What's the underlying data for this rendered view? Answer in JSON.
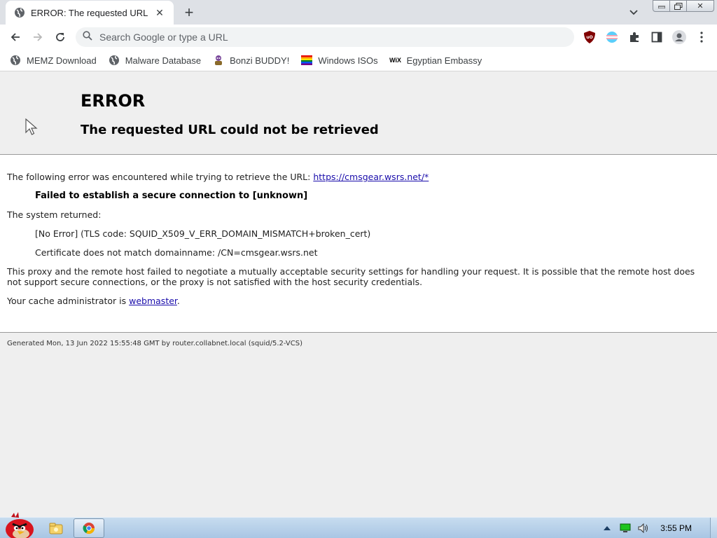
{
  "browser": {
    "tab_title": "ERROR: The requested URL co",
    "omnibox_placeholder": "Search Google or type a URL",
    "bookmarks": [
      {
        "label": "MEMZ Download",
        "icon": "globe-icon"
      },
      {
        "label": "Malware Database",
        "icon": "globe-icon"
      },
      {
        "label": "Bonzi BUDDY!",
        "icon": "bonzi-icon"
      },
      {
        "label": "Windows ISOs",
        "icon": "rainbow-flag-icon"
      },
      {
        "label": "Egyptian Embassy",
        "icon": "wix-icon"
      }
    ]
  },
  "page": {
    "heading": "ERROR",
    "subheading": "The requested URL could not be retrieved",
    "intro_text": "The following error was encountered while trying to retrieve the URL: ",
    "intro_link": "https://cmsgear.wsrs.net/*",
    "error_title": "Failed to establish a secure connection to [unknown]",
    "system_returned": "The system returned:",
    "tls_error": "[No Error] (TLS code: SQUID_X509_V_ERR_DOMAIN_MISMATCH+broken_cert)",
    "cert_error": "Certificate does not match domainname: /CN=cmsgear.wsrs.net",
    "explanation": "This proxy and the remote host failed to negotiate a mutually acceptable security settings for handling your request. It is possible that the remote host does not support secure connections, or the proxy is not satisfied with the host security credentials.",
    "admin_text": "Your cache administrator is ",
    "admin_link": "webmaster",
    "admin_period": ".",
    "footer": "Generated Mon, 13 Jun 2022 15:55:48 GMT by router.collabnet.local (squid/5.2-VCS)"
  },
  "taskbar": {
    "clock": "3:55 PM"
  }
}
